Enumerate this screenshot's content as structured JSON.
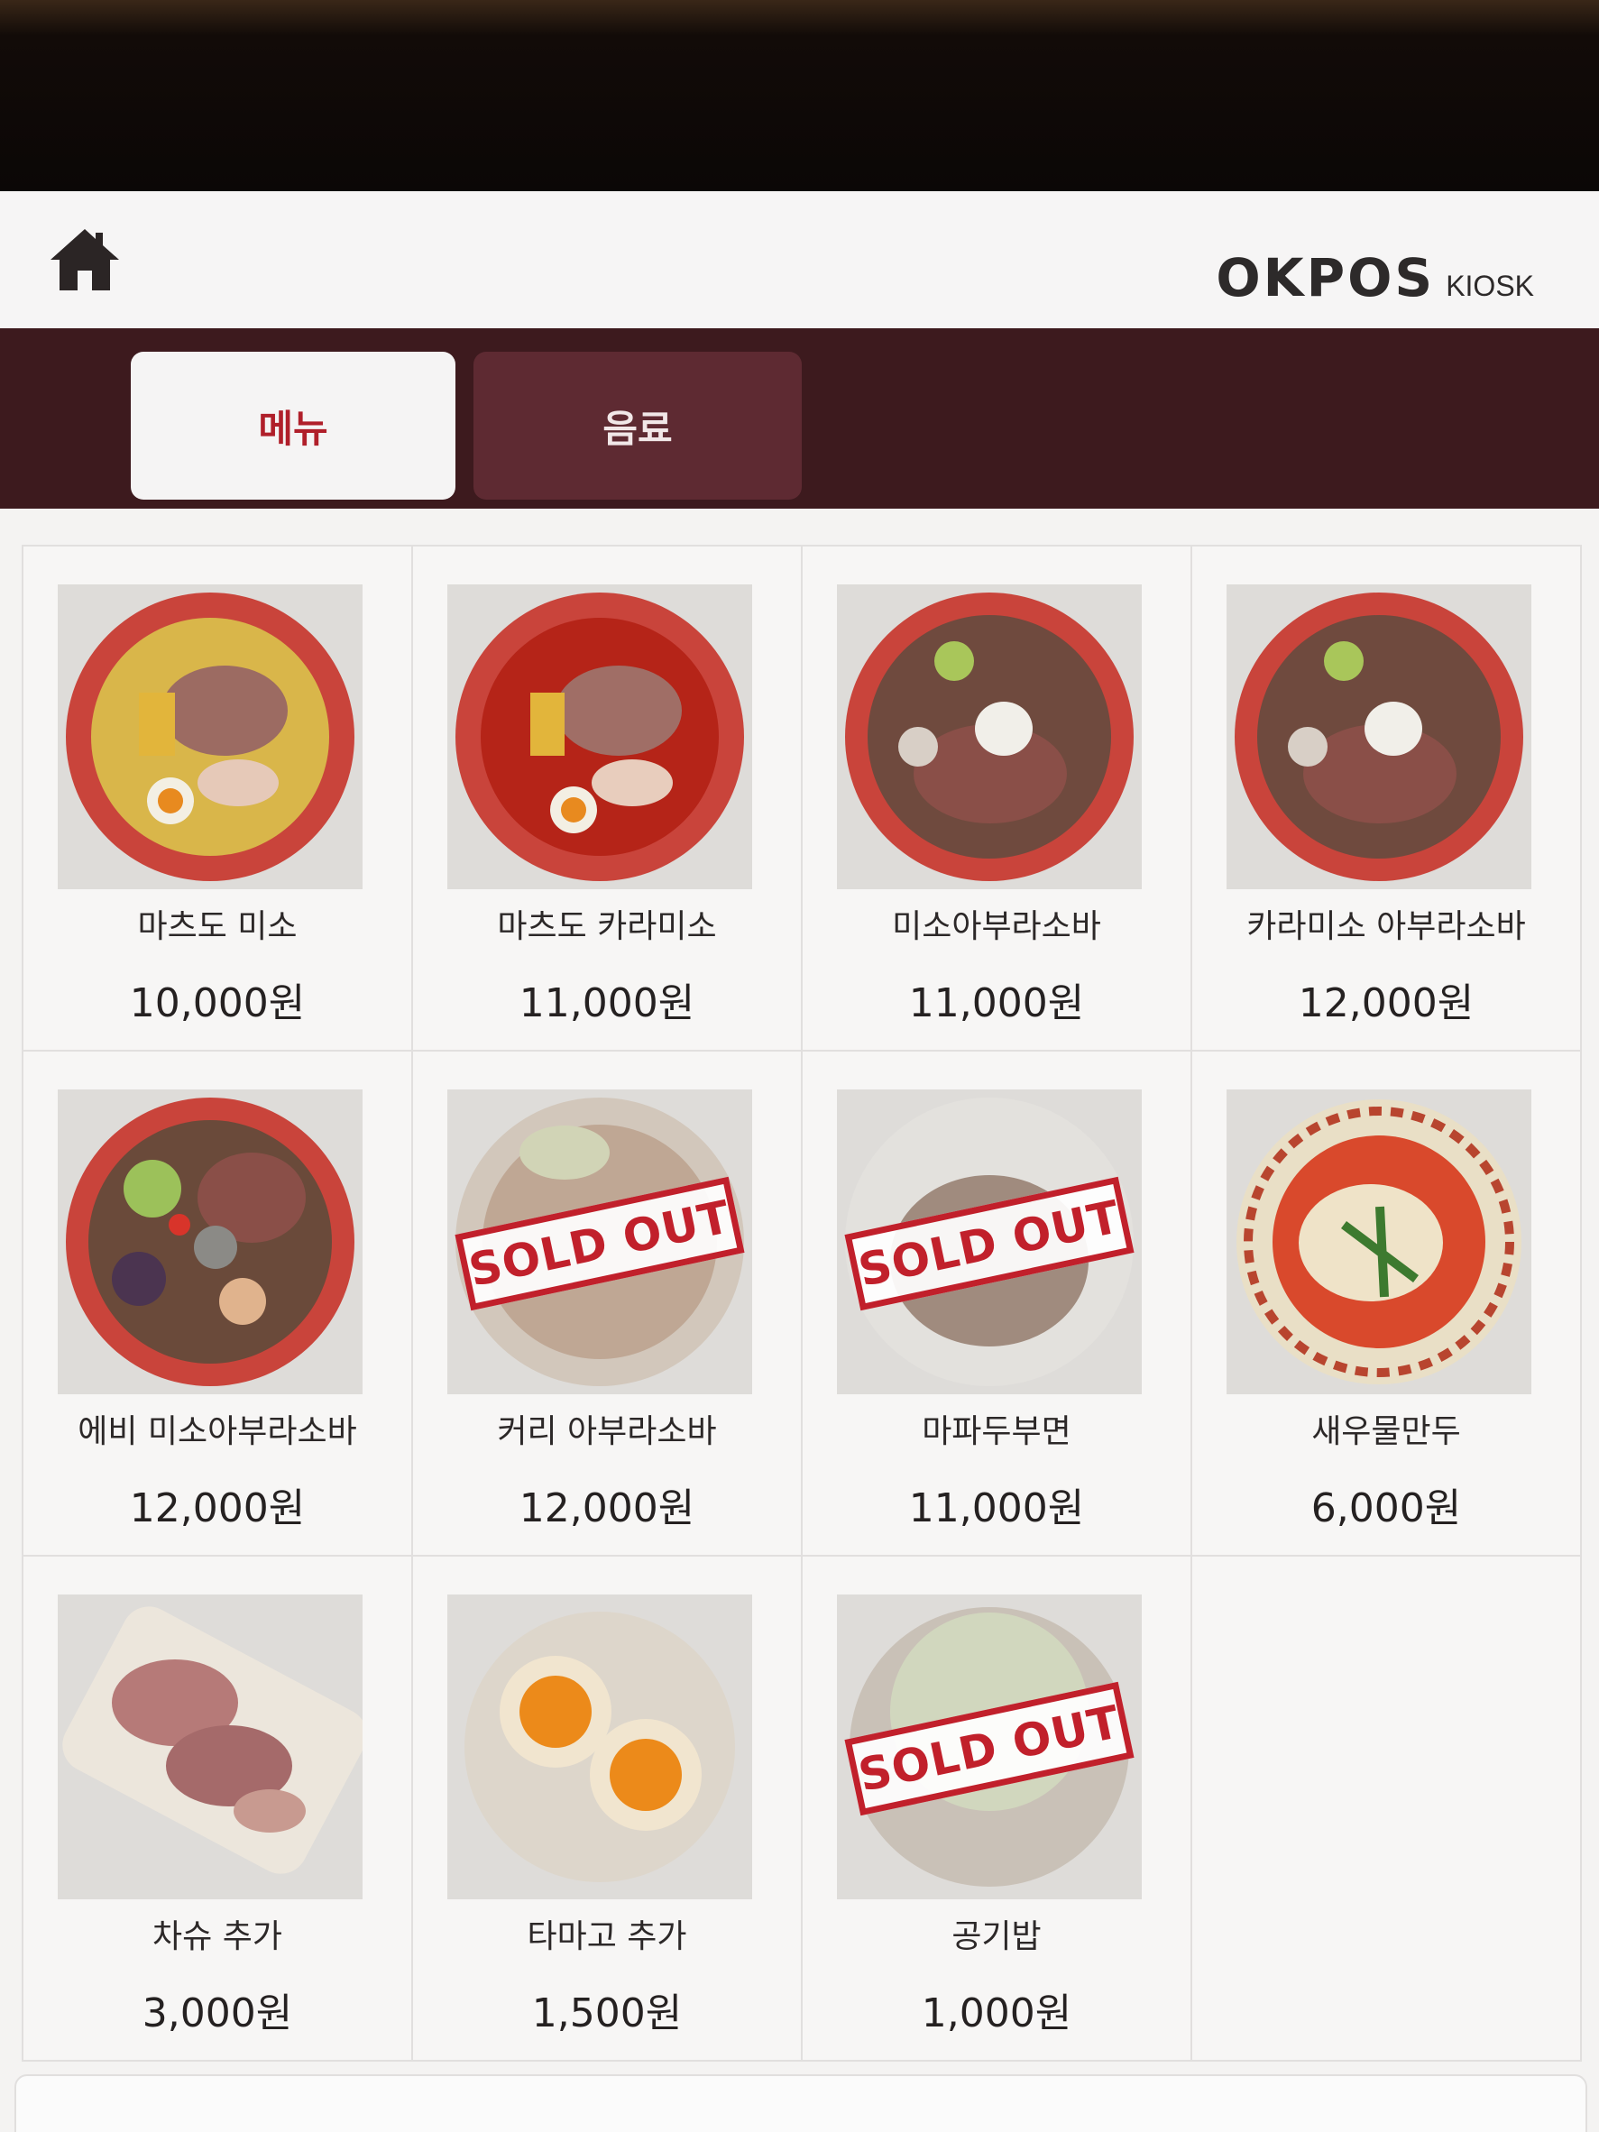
{
  "header": {
    "brand": "OKPOS",
    "brand_sub": "KIOSK",
    "icon": "home-icon"
  },
  "tabs": [
    {
      "label": "메뉴",
      "active": true
    },
    {
      "label": "음료",
      "active": false
    }
  ],
  "sold_out_text": "SOLD OUT",
  "colors": {
    "accent": "#b01f2a",
    "tabbar": "#3d1a1e",
    "inactive_tab": "#5e2a32",
    "sold_out": "#c1202b"
  },
  "menu": [
    {
      "name": "마츠도 미소",
      "price": "10,000원",
      "sold_out": false
    },
    {
      "name": "마츠도 카라미소",
      "price": "11,000원",
      "sold_out": false
    },
    {
      "name": "미소아부라소바",
      "price": "11,000원",
      "sold_out": false
    },
    {
      "name": "카라미소 아부라소바",
      "price": "12,000원",
      "sold_out": false
    },
    {
      "name": "에비 미소아부라소바",
      "price": "12,000원",
      "sold_out": false
    },
    {
      "name": "커리 아부라소바",
      "price": "12,000원",
      "sold_out": true
    },
    {
      "name": "마파두부면",
      "price": "11,000원",
      "sold_out": true
    },
    {
      "name": "새우물만두",
      "price": "6,000원",
      "sold_out": false
    },
    {
      "name": "차슈 추가",
      "price": "3,000원",
      "sold_out": false
    },
    {
      "name": "타마고 추가",
      "price": "1,500원",
      "sold_out": false
    },
    {
      "name": "공기밥",
      "price": "1,000원",
      "sold_out": true
    }
  ]
}
